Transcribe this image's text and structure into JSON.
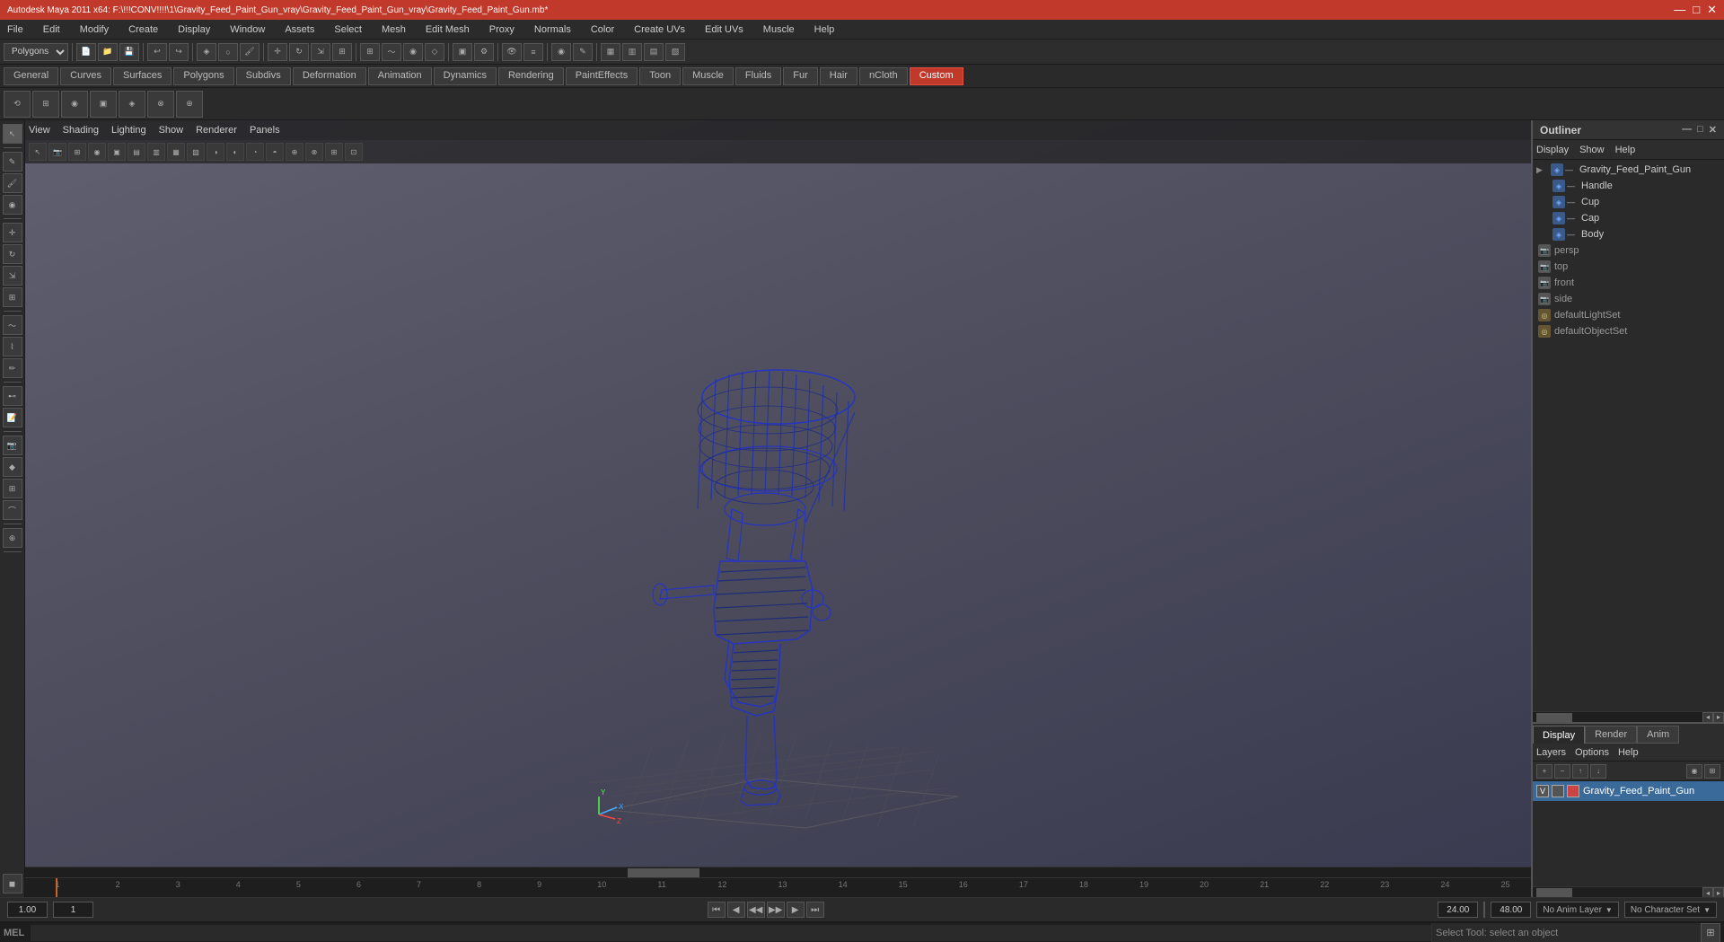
{
  "titleBar": {
    "title": "Autodesk Maya 2011 x64: F:\\!!!CONV!!!!\\1\\Gravity_Feed_Paint_Gun_vray\\Gravity_Feed_Paint_Gun_vray\\Gravity_Feed_Paint_Gun.mb*",
    "minimizeBtn": "—",
    "restoreBtn": "□",
    "closeBtn": "✕"
  },
  "menuBar": {
    "items": [
      "File",
      "Edit",
      "Modify",
      "Create",
      "Display",
      "Window",
      "Assets",
      "Select",
      "Mesh",
      "Edit Mesh",
      "Proxy",
      "Normals",
      "Color",
      "Create UVs",
      "Edit UVs",
      "Muscle",
      "Help"
    ]
  },
  "toolbar1": {
    "dropdownLabel": "Polygons"
  },
  "shelfTabs": {
    "tabs": [
      "General",
      "Curves",
      "Surfaces",
      "Polygons",
      "Subdivs",
      "Deformation",
      "Animation",
      "Dynamics",
      "Rendering",
      "PaintEffects",
      "Toon",
      "Muscle",
      "Fluids",
      "Fur",
      "Hair",
      "nCloth",
      "Custom"
    ]
  },
  "viewportMenu": {
    "items": [
      "View",
      "Shading",
      "Lighting",
      "Show",
      "Renderer",
      "Panels"
    ]
  },
  "outliner": {
    "title": "Outliner",
    "menuItems": [
      "Display",
      "Show",
      "Help"
    ],
    "treeItems": [
      {
        "name": "Gravity_Feed_Paint_Gun",
        "type": "mesh",
        "indent": 0,
        "icon": "▶"
      },
      {
        "name": "Handle",
        "type": "mesh",
        "indent": 1,
        "icon": "—"
      },
      {
        "name": "Cup",
        "type": "mesh",
        "indent": 1,
        "icon": "—"
      },
      {
        "name": "Cap",
        "type": "mesh",
        "indent": 1,
        "icon": "—"
      },
      {
        "name": "Body",
        "type": "mesh",
        "indent": 1,
        "icon": "—"
      },
      {
        "name": "persp",
        "type": "camera",
        "indent": 0,
        "icon": ""
      },
      {
        "name": "top",
        "type": "camera",
        "indent": 0,
        "icon": ""
      },
      {
        "name": "front",
        "type": "camera",
        "indent": 0,
        "icon": ""
      },
      {
        "name": "side",
        "type": "camera",
        "indent": 0,
        "icon": ""
      },
      {
        "name": "defaultLightSet",
        "type": "set",
        "indent": 0,
        "icon": ""
      },
      {
        "name": "defaultObjectSet",
        "type": "set",
        "indent": 0,
        "icon": ""
      }
    ]
  },
  "layerPanel": {
    "tabs": [
      "Display",
      "Render",
      "Anim"
    ],
    "activeTab": "Display",
    "subMenu": [
      "Layers",
      "Options",
      "Help"
    ],
    "layerItem": "Gravity_Feed_Paint_Gun"
  },
  "timeline": {
    "startFrame": "1.00",
    "endFrame": "24.00",
    "currentFrame": "1",
    "playbackStart": "1.00",
    "playbackEnd": "48.00",
    "animLayer": "No Anim Layer",
    "characterSet": "No Character Set",
    "ticks": [
      "1",
      "2",
      "3",
      "4",
      "5",
      "6",
      "7",
      "8",
      "9",
      "10",
      "11",
      "12",
      "13",
      "14",
      "15",
      "16",
      "17",
      "18",
      "19",
      "20",
      "21",
      "22",
      "23",
      "24",
      "25"
    ]
  },
  "transportButtons": {
    "goToStart": "⏮",
    "stepBack": "⏪",
    "playBack": "◀",
    "play": "▶",
    "stepForward": "⏩",
    "goToEnd": "⏭"
  },
  "mel": {
    "label": "MEL",
    "placeholder": "",
    "statusText": "Select Tool: select an object"
  }
}
